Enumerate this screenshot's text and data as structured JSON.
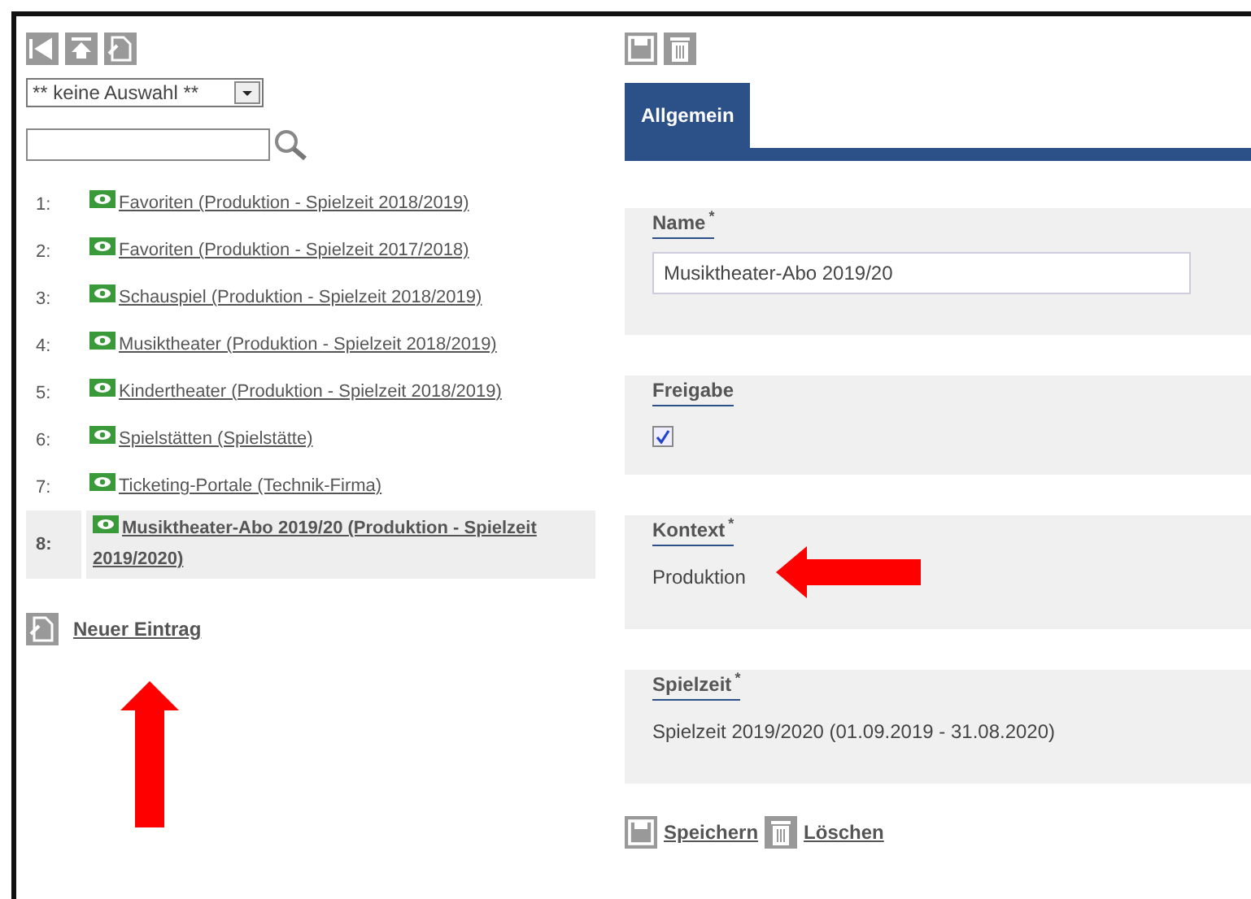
{
  "filter": {
    "value": "** keine Auswahl **"
  },
  "entries": [
    {
      "number": "1:",
      "label": "Favoriten (Produktion - Spielzeit 2018/2019)",
      "selected": false
    },
    {
      "number": "2:",
      "label": "Favoriten (Produktion - Spielzeit 2017/2018)",
      "selected": false
    },
    {
      "number": "3:",
      "label": "Schauspiel (Produktion - Spielzeit 2018/2019)",
      "selected": false
    },
    {
      "number": "4:",
      "label": "Musiktheater (Produktion - Spielzeit 2018/2019)",
      "selected": false
    },
    {
      "number": "5:",
      "label": "Kindertheater (Produktion - Spielzeit 2018/2019)",
      "selected": false
    },
    {
      "number": "6:",
      "label": "Spielstätten (Spielstätte)",
      "selected": false
    },
    {
      "number": "7:",
      "label": "Ticketing-Portale (Technik-Firma)",
      "selected": false
    },
    {
      "number": "8:",
      "label": "Musiktheater-Abo 2019/20 (Produktion - Spielzeit 2019/2020)",
      "selected": true
    }
  ],
  "new_entry": {
    "label": "Neuer Eintrag"
  },
  "tabs": [
    {
      "label": "Allgemein",
      "selected": true
    }
  ],
  "fields": [
    {
      "kind": "input",
      "label": "Name$^{*}$",
      "value": "Musiktheater-Abo 2019/20"
    },
    {
      "kind": "checkbox",
      "label": "Freigabe",
      "checked": true
    },
    {
      "kind": "text",
      "label": "Kontext$^{*}$",
      "value": "Produktion",
      "arrow": true
    },
    {
      "kind": "text",
      "label": "Spielzeit$^{*}$",
      "value": "Spielzeit 2019/2020 (01.09.2019 - 31.08.2020)"
    }
  ],
  "actions": [
    {
      "kind": "save",
      "label": "Speichern"
    },
    {
      "kind": "delete",
      "label": "Löschen"
    }
  ]
}
